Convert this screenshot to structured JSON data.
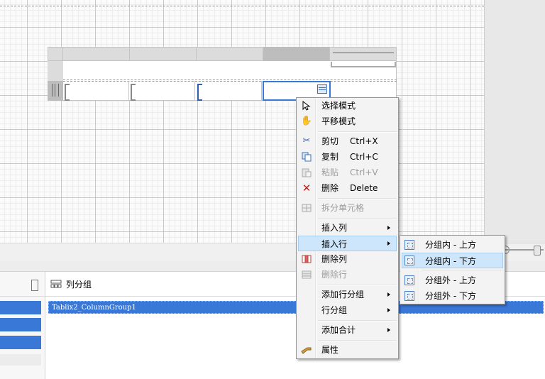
{
  "context_menu": {
    "items": [
      {
        "label": "选择模式",
        "shortcut": "",
        "icon": "pointer-icon",
        "disabled": false
      },
      {
        "label": "平移模式",
        "shortcut": "",
        "icon": "hand-icon",
        "disabled": false
      },
      {
        "label": "剪切",
        "shortcut": "Ctrl+X",
        "icon": "scissors-icon",
        "disabled": false
      },
      {
        "label": "复制",
        "shortcut": "Ctrl+C",
        "icon": "copy-icon",
        "disabled": false
      },
      {
        "label": "粘贴",
        "shortcut": "Ctrl+V",
        "icon": "paste-icon",
        "disabled": true
      },
      {
        "label": "删除",
        "shortcut": "Delete",
        "icon": "delete-icon",
        "disabled": false
      },
      {
        "label": "拆分单元格",
        "shortcut": "",
        "icon": "split-cells-icon",
        "disabled": true
      },
      {
        "label": "插入列",
        "submenu": true
      },
      {
        "label": "插入行",
        "submenu": true,
        "highlighted": true
      },
      {
        "label": "删除列",
        "icon": "delete-column-icon",
        "disabled": false
      },
      {
        "label": "删除行",
        "icon": "delete-row-icon",
        "disabled": true
      },
      {
        "label": "添加行分组",
        "submenu": true
      },
      {
        "label": "行分组",
        "submenu": true
      },
      {
        "label": "添加合计",
        "submenu": true
      },
      {
        "label": "属性",
        "icon": "properties-icon",
        "disabled": false
      }
    ]
  },
  "insert_row_submenu": {
    "items": [
      {
        "label": "分组内 - 上方"
      },
      {
        "label": "分组内 - 下方",
        "highlighted": true
      },
      {
        "label": "分组外 - 上方"
      },
      {
        "label": "分组外 - 下方"
      }
    ]
  },
  "column_groups": {
    "title": "列分组",
    "selected_group": "Tablix2_ColumnGroup1"
  },
  "colors": {
    "selection": "#3a78d8",
    "menu_highlight": "#cde6fb",
    "delete_icon": "#d11a1a"
  }
}
